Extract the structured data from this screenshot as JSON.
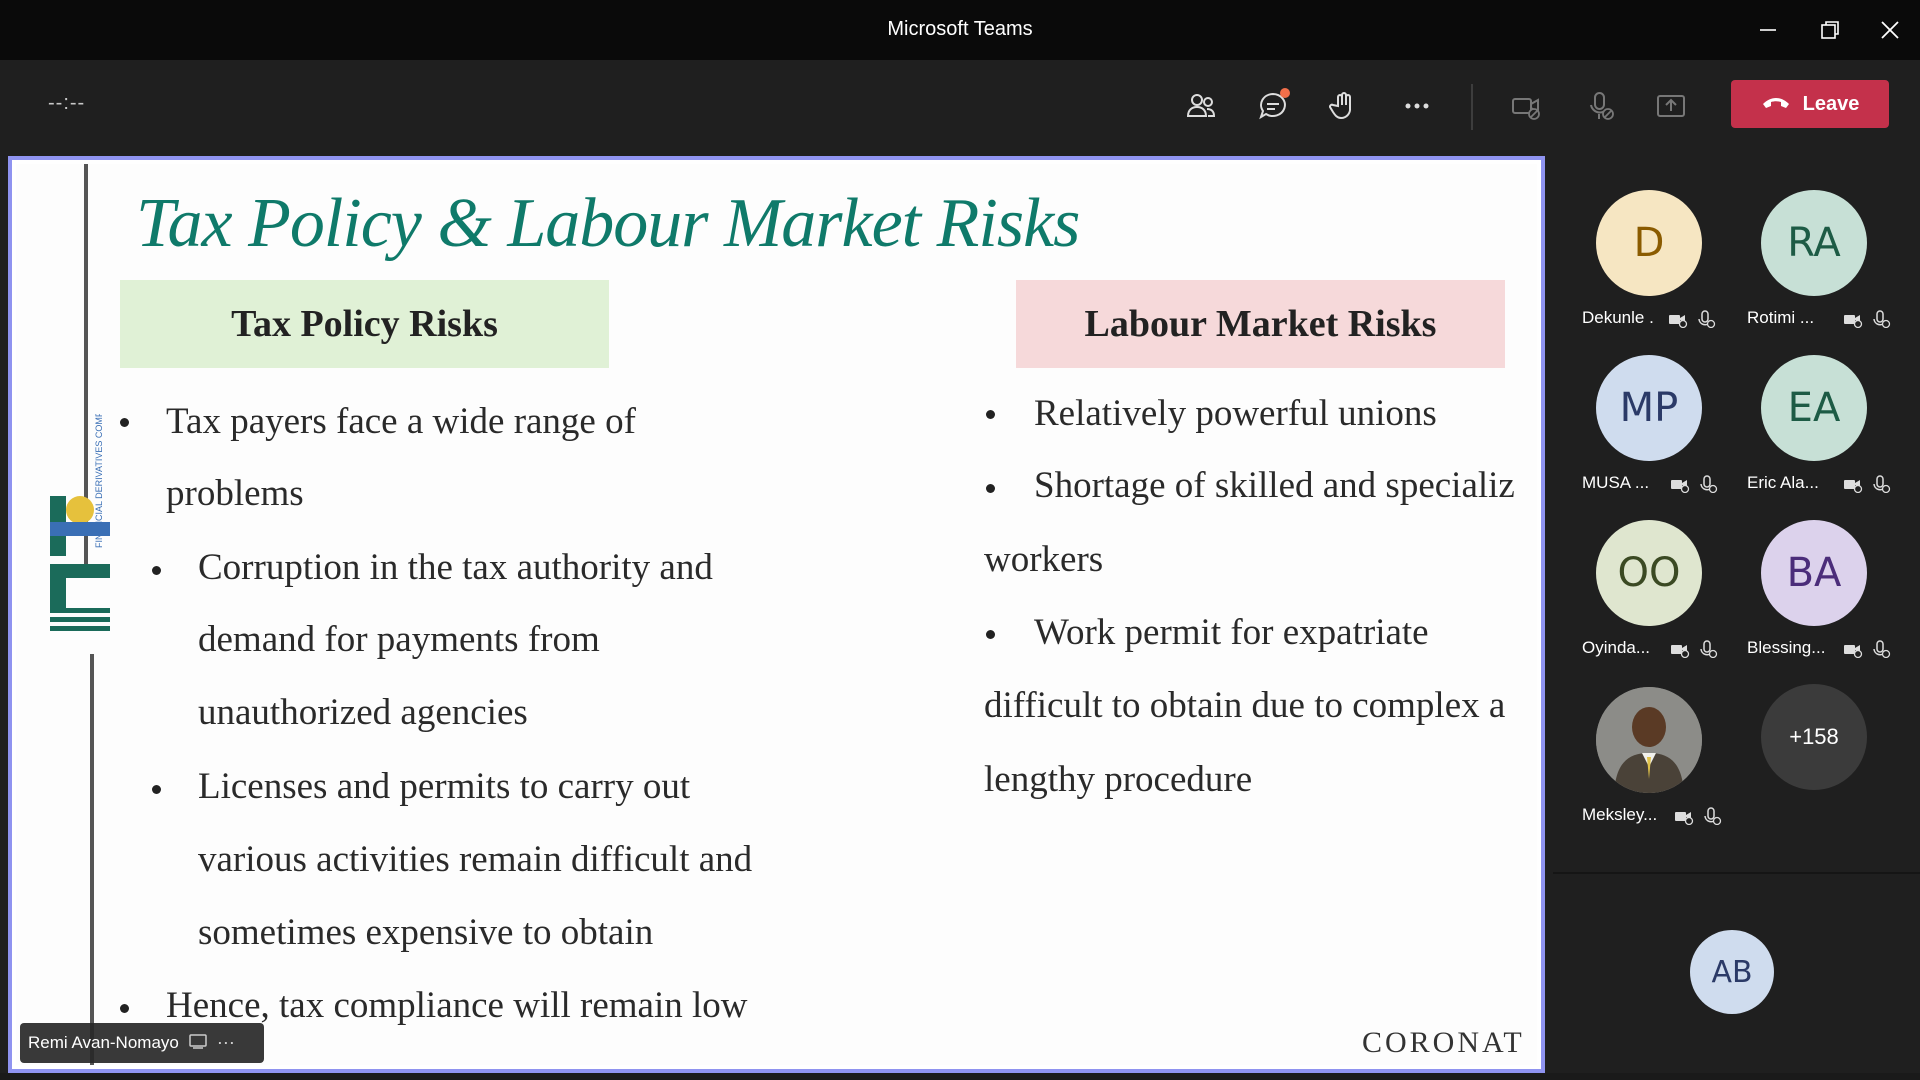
{
  "window": {
    "title": "Microsoft Teams"
  },
  "toolbar": {
    "timer": "--:--",
    "leave_label": "Leave",
    "icons": [
      "people-icon",
      "chat-icon",
      "raise-hand-icon",
      "more-icon",
      "camera-off-icon",
      "mic-off-icon",
      "share-icon"
    ]
  },
  "slide": {
    "title": "Tax Policy & Labour Market Risks",
    "left_header": "Tax Policy Risks",
    "right_header": "Labour Market Risks",
    "left_lines": [
      "Tax payers face a wide range of",
      "problems",
      "Corruption in the tax authority and",
      "demand for payments from",
      "unauthorized agencies",
      "Licenses and permits to carry out",
      "various activities remain difficult and",
      "sometimes expensive to obtain",
      "Hence, tax compliance will remain low"
    ],
    "right_lines": [
      "Relatively powerful unions",
      "Shortage of  skilled and specializ",
      "workers",
      "Work permit for expatriate",
      "difficult to obtain due to complex a",
      "lengthy procedure"
    ],
    "footer_brand": "CORONAT",
    "logo_text": "FDC"
  },
  "presenter": {
    "name": "Remi Avan-Nomayo"
  },
  "participants": [
    {
      "initials": "D",
      "name": "Dekunle .",
      "bg": "#f6e6c2",
      "fg": "#8a5b00"
    },
    {
      "initials": "RA",
      "name": "Rotimi ...",
      "bg": "#c7e0d6",
      "fg": "#1d5b45"
    },
    {
      "initials": "MP",
      "name": "MUSA ...",
      "bg": "#cfdcee",
      "fg": "#2b3a67"
    },
    {
      "initials": "EA",
      "name": "Eric Ala...",
      "bg": "#c7e0d6",
      "fg": "#1d5b45"
    },
    {
      "initials": "OO",
      "name": "Oyinda...",
      "bg": "#dfe6cf",
      "fg": "#3b4a23"
    },
    {
      "initials": "BA",
      "name": "Blessing...",
      "bg": "#dcd2ec",
      "fg": "#4b2d7a"
    },
    {
      "initials": "",
      "name": "Meksley...",
      "bg": "#6b6b6b",
      "fg": "#ffffff"
    }
  ],
  "more_participants": "+158",
  "self_initials": "AB",
  "colors": {
    "leave": "#c4314b",
    "stage_border": "#8f93f0",
    "slide_title": "#0f7a6a"
  }
}
